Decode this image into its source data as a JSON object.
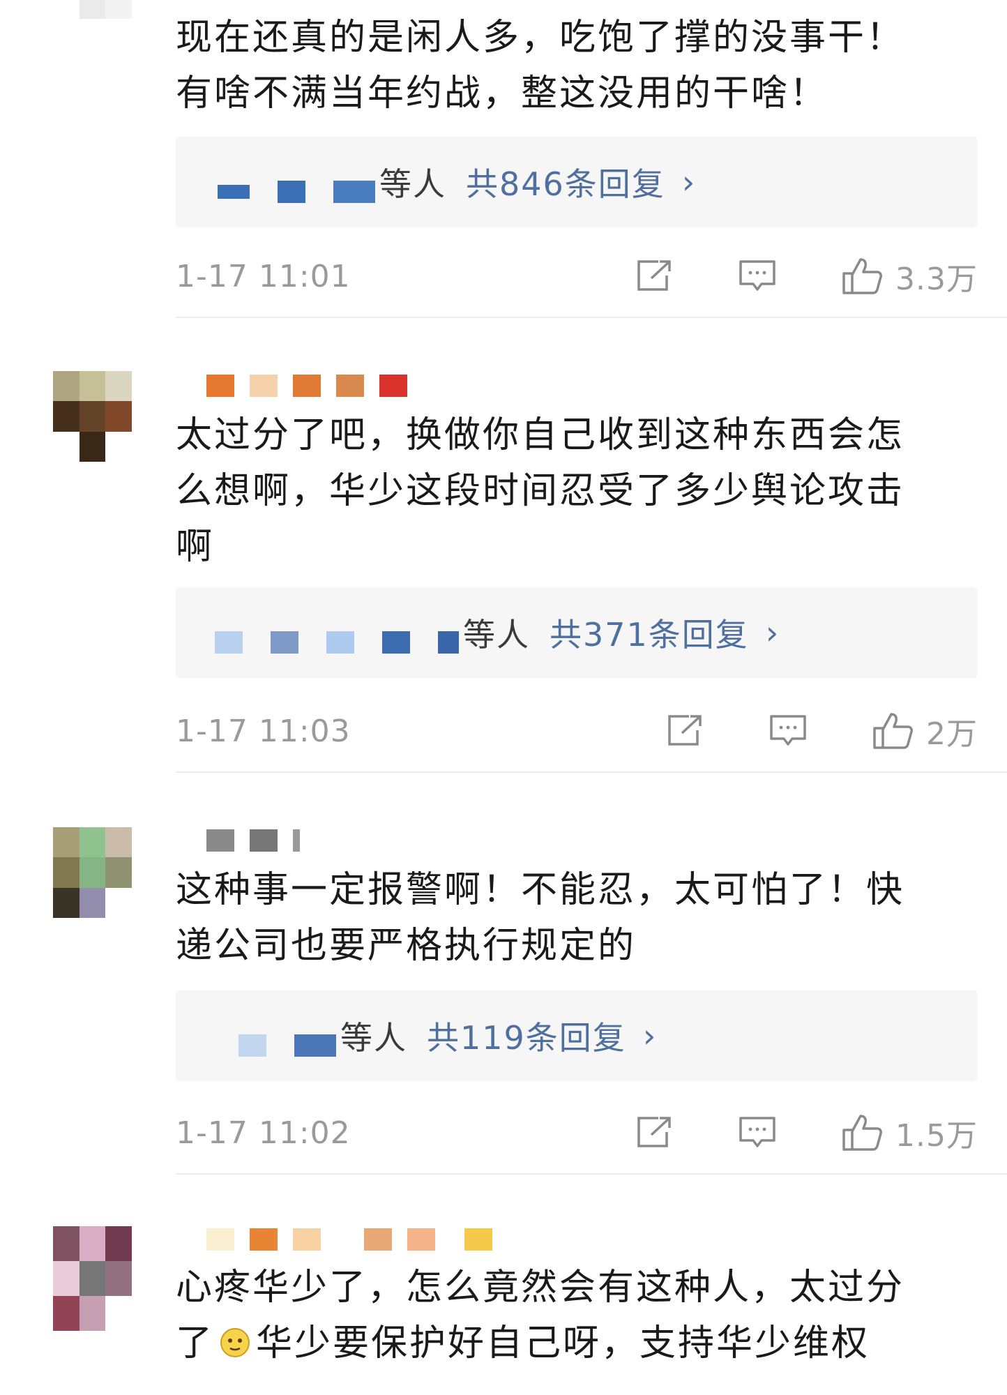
{
  "icons": {
    "share": "share-icon",
    "comment": "comment-icon",
    "like": "thumbs-up-icon",
    "chevron": "chevron-right-icon"
  },
  "comments": [
    {
      "text_lines": [
        "现在还真的是闲人多，吃饱了撑的没事干！",
        "有啥不满当年约战，整这没用的干啥！"
      ],
      "reply_who": "等人",
      "reply_count": "共846条回复",
      "reply_arrow": "›",
      "time": "1-17 11:01",
      "likes": "3.3万"
    },
    {
      "text_lines": [
        "太过分了吧，换做你自己收到这种东西会怎",
        "么想啊，华少这段时间忍受了多少舆论攻击",
        "啊"
      ],
      "reply_who": "等人",
      "reply_count": "共371条回复",
      "reply_arrow": "›",
      "time": "1-17 11:03",
      "likes": "2万"
    },
    {
      "text_lines": [
        "这种事一定报警啊！不能忍，太可怕了！快",
        "递公司也要严格执行规定的"
      ],
      "reply_who": "等人",
      "reply_count": "共119条回复",
      "reply_arrow": "›",
      "time": "1-17 11:02",
      "likes": "1.5万"
    },
    {
      "text_lines": [
        "心疼华少了，怎么竟然会有这种人，太过分",
        "了",
        "华少要保护好自己呀，支持华少维权"
      ]
    }
  ]
}
